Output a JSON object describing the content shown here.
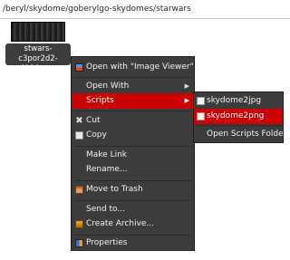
{
  "path": {
    "text": "/beryl/skydome/goberylgo-skydomes/starwars"
  },
  "file": {
    "name": "stwars-c3por2d2-4096.png"
  },
  "menu": {
    "open_with_viewer": "Open with \"Image Viewer\"",
    "open_with": "Open With",
    "scripts": "Scripts",
    "cut": "Cut",
    "copy": "Copy",
    "make_link": "Make Link",
    "rename": "Rename...",
    "move_to_trash": "Move to Trash",
    "send_to": "Send to...",
    "create_archive": "Create Archive...",
    "properties": "Properties"
  },
  "submenu": {
    "items": [
      "skydome2jpg",
      "skydome2png"
    ],
    "open_folder": "Open Scripts Folder"
  },
  "colors": {
    "highlight": "#cc0000",
    "menu_bg": "#3c3c3c"
  },
  "icons": {
    "open_with_viewer": "image-viewer-icon",
    "cut": "scissors-icon",
    "copy": "copy-icon",
    "move_to_trash": "trash-icon",
    "create_archive": "archive-icon",
    "properties": "properties-icon",
    "scripts": "script-icon"
  }
}
